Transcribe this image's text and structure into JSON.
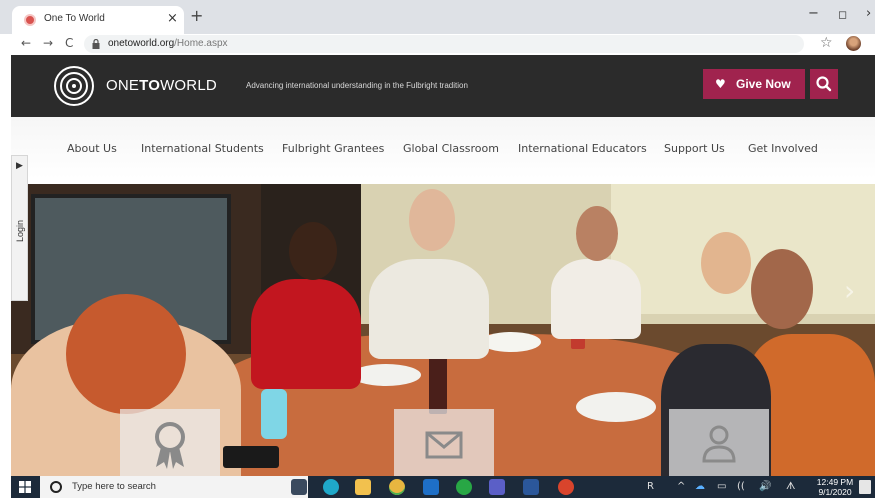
{
  "browser": {
    "tab_title": "One To World",
    "tab_close": "×",
    "new_tab": "+",
    "url_domain": "onetoworld.org",
    "url_path": "/Home.aspx",
    "window_min": "−",
    "window_max": "◻",
    "window_close": "›",
    "nav_back": "←",
    "nav_forward": "→",
    "nav_reload": "C",
    "star": "☆"
  },
  "header": {
    "logo_text_pre": "ONE",
    "logo_text_bold": "TO",
    "logo_text_post": "WORLD",
    "tagline": "Advancing international understanding in the Fulbright tradition",
    "give_now_label": "Give Now",
    "heart": "♥",
    "brand_color": "#a0234e"
  },
  "nav": {
    "items": [
      "About Us",
      "International Students",
      "Fulbright Grantees",
      "Global Classroom",
      "International Educators",
      "Support Us",
      "Get Involved"
    ]
  },
  "login_tab": {
    "arrow": "▶",
    "label": "Login"
  },
  "hero": {
    "next_arrow": "›",
    "quick_links": [
      "award-icon",
      "envelope-icon",
      "person-icon"
    ]
  },
  "taskbar": {
    "search_placeholder": "Type here to search",
    "mic": "🎙",
    "clock_time": "12:49 PM",
    "clock_date": "9/1/2020",
    "tray_items": [
      "R",
      "^",
      "☁",
      "▭",
      "((",
      "🔊",
      "ᗑ"
    ]
  }
}
